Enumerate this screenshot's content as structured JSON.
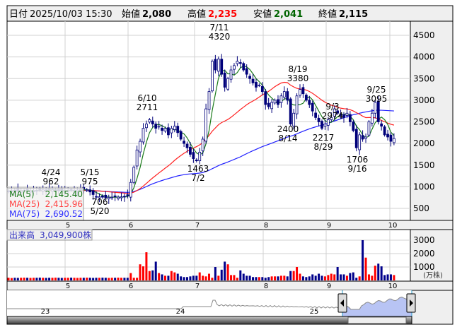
{
  "header": {
    "date_label": "日付",
    "date_value": "2025/10/03 15:30",
    "open_label": "始値",
    "open_value": "2,080",
    "high_label": "高値",
    "high_value": "2,235",
    "low_label": "安値",
    "low_value": "2,041",
    "close_label": "終値",
    "close_value": "2,115"
  },
  "legend": {
    "ma5_label": "MA(5)",
    "ma5_value": "2,145.40",
    "ma25_label": "MA(25)",
    "ma25_value": "2,415.96",
    "ma75_label": "MA(75)",
    "ma75_value": "2,690.52"
  },
  "volume_panel": {
    "label": "出来高",
    "value": "3,049,900株",
    "unit": "(万株)"
  },
  "navigator": {
    "year_labels": [
      "23",
      "24",
      "25"
    ]
  },
  "colors": {
    "up_volume": "#ff0000",
    "down_volume": "#00008b",
    "ma5": "#1a7a1a",
    "ma25": "#ff2020",
    "ma75": "#2020ff",
    "candle": "#00007a",
    "high": "#ff0000",
    "low": "#006400"
  },
  "annotations": [
    {
      "top": "4/24",
      "bottom": "962"
    },
    {
      "top": "5/15",
      "bottom": "975"
    },
    {
      "top": "706",
      "bottom": "5/20"
    },
    {
      "top": "6/10",
      "bottom": "2711"
    },
    {
      "top": "1463",
      "bottom": "7/2"
    },
    {
      "top": "7/11",
      "bottom": "4320"
    },
    {
      "top": "8/19",
      "bottom": "3380"
    },
    {
      "top": "2400",
      "bottom": "8/14"
    },
    {
      "top": "9/3",
      "bottom": "2974"
    },
    {
      "top": "2217",
      "bottom": "8/29"
    },
    {
      "top": "9/25",
      "bottom": "3095"
    },
    {
      "top": "1706",
      "bottom": "9/16"
    }
  ],
  "chart_data": {
    "type": "candlestick",
    "x_tick_labels": [
      "5",
      "6",
      "7",
      "8",
      "9",
      "10"
    ],
    "price_ticks": [
      "500",
      "1000",
      "1500",
      "2000",
      "2500",
      "3000",
      "3500",
      "4000",
      "4500"
    ],
    "price_range": [
      500,
      4500
    ],
    "volume_ticks": [
      "1000",
      "2000",
      "3000"
    ],
    "volume_range": [
      0,
      3000
    ],
    "closes": [
      900,
      905,
      910,
      895,
      900,
      915,
      920,
      905,
      900,
      910,
      920,
      930,
      925,
      940,
      930,
      925,
      910,
      905,
      900,
      910,
      920,
      915,
      925,
      940,
      945,
      930,
      880,
      820,
      760,
      770,
      760,
      750,
      755,
      760,
      770,
      760,
      765,
      770,
      790,
      1100,
      1450,
      1850,
      2050,
      2350,
      2450,
      2550,
      2450,
      2350,
      2400,
      2300,
      2350,
      2200,
      2350,
      2400,
      2250,
      2100,
      2000,
      1900,
      1750,
      1650,
      1600,
      1800,
      2100,
      2800,
      3200,
      3900,
      3700,
      3950,
      3600,
      3300,
      3500,
      3700,
      3800,
      3900,
      3850,
      3700,
      3600,
      3500,
      3400,
      3300,
      3350,
      3200,
      2900,
      2850,
      2950,
      3000,
      2900,
      3100,
      3200,
      3000,
      2450,
      2700,
      3100,
      3250,
      3150,
      3000,
      2900,
      2750,
      2600,
      2500,
      2350,
      2450,
      2550,
      2600,
      2800,
      2700,
      2650,
      2600,
      2700,
      2500,
      2300,
      1900,
      2200,
      2100,
      2150,
      2500,
      2700,
      2950,
      2500,
      2400,
      2200,
      2150,
      2050,
      2115
    ],
    "volumes": [
      200,
      180,
      200,
      190,
      200,
      210,
      200,
      190,
      200,
      200,
      210,
      200,
      190,
      200,
      200,
      210,
      200,
      190,
      200,
      200,
      210,
      200,
      190,
      200,
      200,
      210,
      200,
      190,
      200,
      200,
      210,
      200,
      190,
      200,
      200,
      210,
      200,
      200,
      200,
      550,
      200,
      200,
      1200,
      1050,
      2100,
      700,
      750,
      1400,
      550,
      450,
      350,
      350,
      700,
      600,
      500,
      300,
      250,
      250,
      300,
      350,
      350,
      600,
      350,
      300,
      500,
      200,
      1000,
      350,
      800,
      1400,
      1200,
      400,
      400,
      200,
      750,
      500,
      350,
      350,
      250,
      250,
      250,
      250,
      200,
      250,
      300,
      300,
      300,
      350,
      350,
      300,
      700,
      700,
      1000,
      500,
      300,
      250,
      300,
      450,
      350,
      500,
      350,
      300,
      400,
      500,
      450,
      1000,
      450,
      450,
      350,
      550,
      600,
      200,
      300,
      3000,
      1700,
      450,
      350,
      1100,
      1250,
      1050,
      400,
      450,
      450,
      400,
      350,
      400
    ]
  }
}
